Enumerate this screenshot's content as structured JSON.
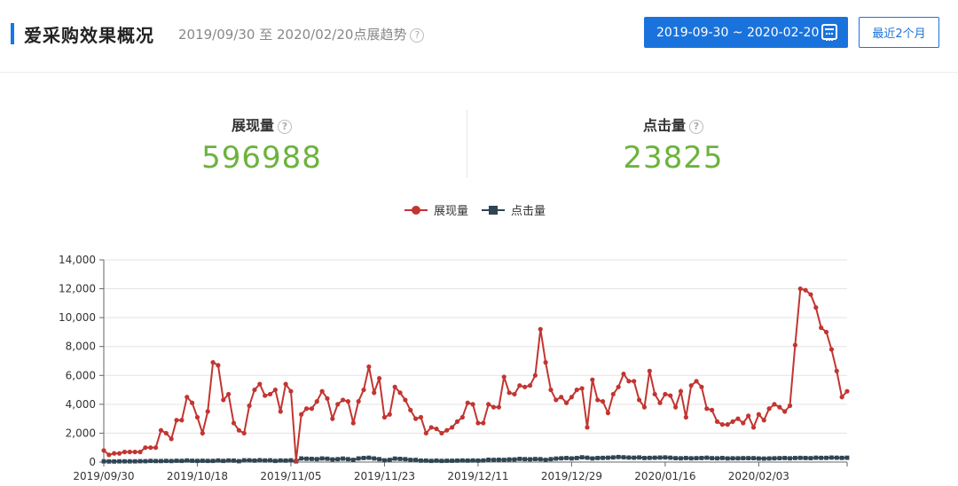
{
  "header": {
    "title": "爱采购效果概况",
    "subtitle": "2019/09/30 至 2020/02/20点展趋势",
    "help_glyph": "?",
    "date_range": "2019-09-30 ~ 2020-02-20",
    "recent_button": "最近2个月",
    "accent_color": "#1a73dc"
  },
  "stats": [
    {
      "label": "展现量",
      "value": "596988"
    },
    {
      "label": "点击量",
      "value": "23825"
    }
  ],
  "chart_data": {
    "type": "line",
    "ylim": [
      0,
      14000
    ],
    "y_ticks": [
      "0",
      "2,000",
      "4,000",
      "6,000",
      "8,000",
      "10,000",
      "12,000",
      "14,000"
    ],
    "x_tick_labels": [
      "2019/09/30",
      "2019/10/18",
      "2019/11/05",
      "2019/11/23",
      "2019/12/11",
      "2019/12/29",
      "2020/01/16",
      "2020/02/03"
    ],
    "x_tick_step_days": 18,
    "grid": true,
    "legend_position": "top-center",
    "series": [
      {
        "name": "展现量",
        "color": "#c23531",
        "marker": "circle",
        "values": [
          800,
          500,
          600,
          600,
          700,
          700,
          700,
          700,
          1000,
          1000,
          1000,
          2200,
          2000,
          1600,
          2900,
          2900,
          4500,
          4100,
          3100,
          2000,
          3500,
          6900,
          6700,
          4300,
          4700,
          2700,
          2200,
          2000,
          3900,
          5000,
          5400,
          4600,
          4700,
          5000,
          3500,
          5400,
          4900,
          100,
          3300,
          3700,
          3700,
          4200,
          4900,
          4400,
          3000,
          4000,
          4300,
          4200,
          2700,
          4200,
          5000,
          6600,
          4800,
          5800,
          3100,
          3300,
          5200,
          4800,
          4300,
          3600,
          3000,
          3100,
          2000,
          2400,
          2300,
          2000,
          2200,
          2400,
          2800,
          3100,
          4100,
          4000,
          2700,
          2700,
          4000,
          3800,
          3800,
          5900,
          4800,
          4700,
          5300,
          5200,
          5300,
          6000,
          9200,
          6900,
          5000,
          4300,
          4500,
          4100,
          4500,
          5000,
          5100,
          2400,
          5700,
          4300,
          4200,
          3400,
          4700,
          5200,
          6100,
          5600,
          5600,
          4300,
          3800,
          6300,
          4700,
          4100,
          4700,
          4600,
          3800,
          4900,
          3100,
          5300,
          5600,
          5200,
          3700,
          3600,
          2800,
          2600,
          2600,
          2800,
          3000,
          2700,
          3200,
          2400,
          3300,
          2900,
          3700,
          4000,
          3800,
          3500,
          3900,
          8100,
          12000,
          11900,
          11600,
          10700,
          9300,
          9000,
          7800,
          6300,
          4500,
          4900
        ]
      },
      {
        "name": "点击量",
        "color": "#2f4554",
        "marker": "square",
        "values": [
          50,
          40,
          40,
          50,
          50,
          50,
          50,
          60,
          60,
          80,
          70,
          70,
          80,
          70,
          90,
          80,
          110,
          90,
          80,
          90,
          80,
          80,
          110,
          80,
          110,
          100,
          60,
          120,
          120,
          100,
          130,
          110,
          120,
          80,
          110,
          100,
          120,
          50,
          250,
          230,
          220,
          200,
          250,
          230,
          180,
          200,
          240,
          200,
          150,
          250,
          280,
          300,
          250,
          200,
          120,
          150,
          240,
          220,
          200,
          150,
          150,
          100,
          100,
          80,
          100,
          80,
          90,
          90,
          100,
          110,
          100,
          110,
          100,
          110,
          160,
          150,
          160,
          150,
          180,
          180,
          220,
          200,
          190,
          210,
          200,
          150,
          200,
          240,
          260,
          280,
          250,
          280,
          330,
          300,
          250,
          280,
          290,
          300,
          320,
          350,
          330,
          310,
          300,
          320,
          280,
          290,
          300,
          310,
          320,
          300,
          270,
          260,
          280,
          260,
          270,
          280,
          300,
          270,
          260,
          280,
          250,
          260,
          260,
          270,
          270,
          270,
          250,
          240,
          250,
          260,
          270,
          280,
          260,
          280,
          290,
          280,
          270,
          300,
          290,
          290,
          310,
          300,
          290,
          300
        ]
      }
    ]
  }
}
